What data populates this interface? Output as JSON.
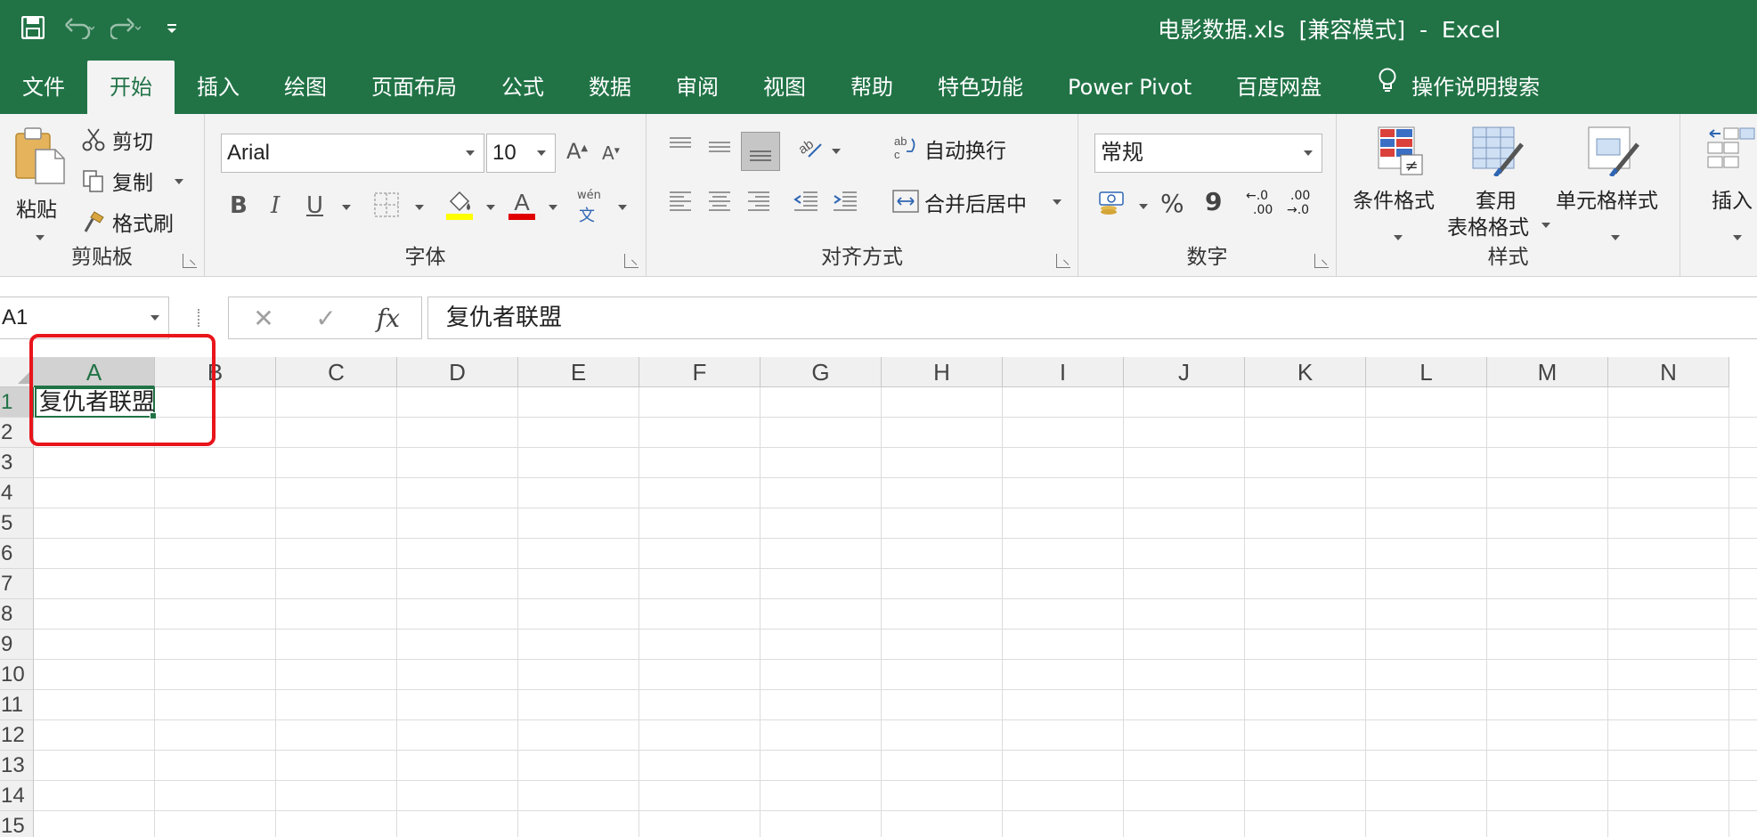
{
  "titlebar": {
    "title": "电影数据.xls  [兼容模式]  -  Excel",
    "bg_color": "#217346"
  },
  "tabs": [
    "文件",
    "开始",
    "插入",
    "绘图",
    "页面布局",
    "公式",
    "数据",
    "审阅",
    "视图",
    "帮助",
    "特色功能",
    "Power Pivot",
    "百度网盘"
  ],
  "active_tab_index": 1,
  "tell_me": "操作说明搜索",
  "ribbon": {
    "clipboard": {
      "label": "剪贴板",
      "paste": "粘贴",
      "cut": "剪切",
      "copy": "复制",
      "format_painter": "格式刷"
    },
    "font": {
      "label": "字体",
      "name": "Arial",
      "size": "10",
      "bold": "B",
      "italic": "I",
      "underline": "U",
      "phonetic_top": "wén",
      "phonetic_bottom": "文"
    },
    "alignment": {
      "label": "对齐方式",
      "wrap": "自动换行",
      "merge": "合并后居中"
    },
    "number": {
      "label": "数字",
      "format": "常规",
      "percent": "%",
      "comma": "9",
      "inc_decimal_top": "←.0",
      "inc_decimal_bottom": ".00",
      "dec_decimal_top": ".00",
      "dec_decimal_bottom": "→.0"
    },
    "styles": {
      "label": "样式",
      "conditional": "条件格式",
      "table_line1": "套用",
      "table_line2": "表格格式",
      "cell_styles": "单元格样式"
    },
    "cells": {
      "insert": "插入"
    }
  },
  "formula_bar": {
    "name_box": "A1",
    "cancel": "✕",
    "enter": "✓",
    "fx": "fx",
    "content": "复仇者联盟"
  },
  "sheet": {
    "columns": [
      "A",
      "B",
      "C",
      "D",
      "E",
      "F",
      "G",
      "H",
      "I",
      "J",
      "K",
      "L",
      "M",
      "N"
    ],
    "rows": [
      "1",
      "2",
      "3",
      "4",
      "5",
      "6",
      "7",
      "8",
      "9",
      "10",
      "11",
      "12",
      "13",
      "14",
      "15"
    ],
    "a1_value": "复仇者联盟",
    "selected_cell": "A1"
  },
  "annotation_color": "#e8151b"
}
